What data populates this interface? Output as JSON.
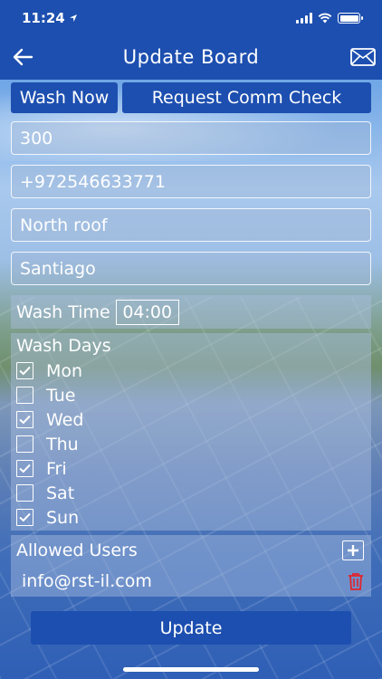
{
  "status_bar": {
    "time": "11:24",
    "location_icon": "location-arrow-icon"
  },
  "nav": {
    "title": "Update Board",
    "back_icon": "back-arrow-icon",
    "mail_icon": "envelope-icon"
  },
  "actions": {
    "wash_now": "Wash Now",
    "request_comm_check": "Request Comm Check"
  },
  "fields": {
    "board_id": "300",
    "phone": "+972546633771",
    "location": "North roof",
    "site": "Santiago"
  },
  "wash_time": {
    "label": "Wash Time",
    "value": "04:00"
  },
  "wash_days": {
    "label": "Wash Days",
    "days": [
      {
        "name": "Mon",
        "checked": true
      },
      {
        "name": "Tue",
        "checked": false
      },
      {
        "name": "Wed",
        "checked": true
      },
      {
        "name": "Thu",
        "checked": false
      },
      {
        "name": "Fri",
        "checked": true
      },
      {
        "name": "Sat",
        "checked": false
      },
      {
        "name": "Sun",
        "checked": true
      }
    ]
  },
  "allowed_users": {
    "label": "Allowed Users",
    "users": [
      {
        "email": "info@rst-il.com"
      }
    ]
  },
  "update_button": "Update",
  "colors": {
    "primary": "#1d4fb0",
    "delete": "#e0242c"
  }
}
